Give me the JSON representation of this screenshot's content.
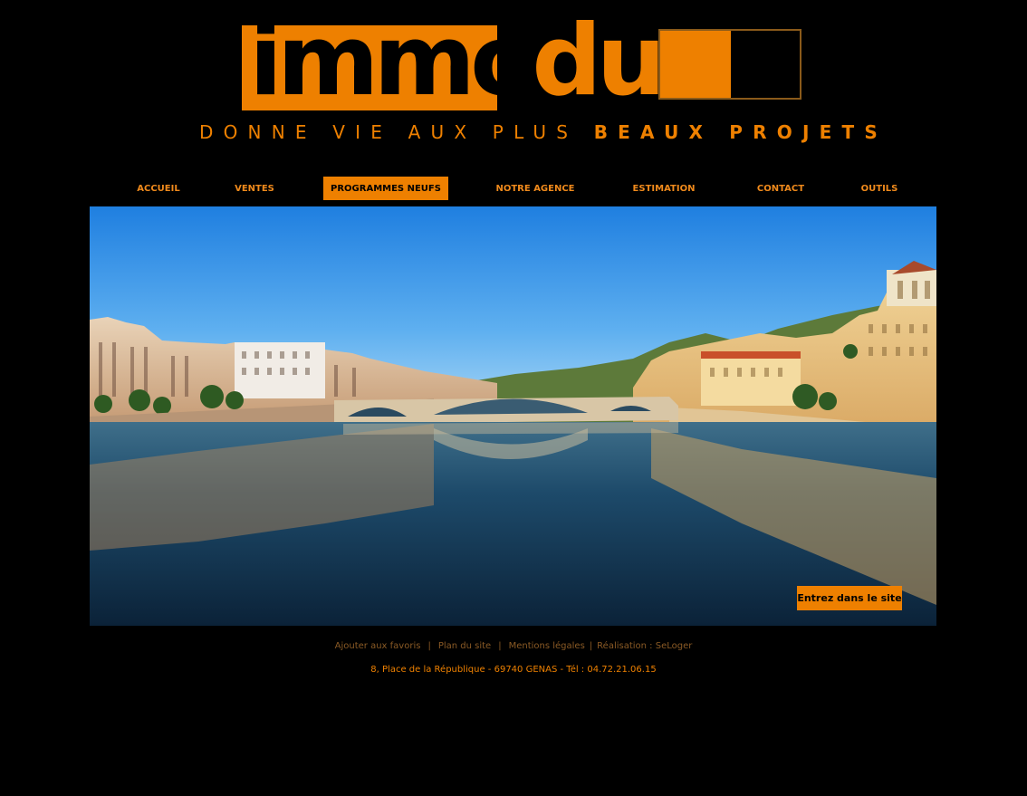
{
  "brand": {
    "logo_text_first": "immo",
    "logo_text_second": "duo",
    "tagline_light": "DONNE VIE AUX PLUS",
    "tagline_bold": "BEAUX PROJETS",
    "accent_color": "#ee8000"
  },
  "nav": {
    "items": [
      {
        "label": "ACCUEIL",
        "active": false
      },
      {
        "label": "VENTES",
        "active": false
      },
      {
        "label": "PROGRAMMES NEUFS",
        "active": true
      },
      {
        "label": "NOTRE AGENCE",
        "active": false
      },
      {
        "label": "ESTIMATION",
        "active": false
      },
      {
        "label": "CONTACT",
        "active": false
      },
      {
        "label": "OUTILS",
        "active": false
      }
    ]
  },
  "hero": {
    "enter_button_label": "Entrez dans le site"
  },
  "footer": {
    "links": [
      {
        "label": "Ajouter aux favoris"
      },
      {
        "label": "Plan du site"
      },
      {
        "label": "Mentions légales"
      },
      {
        "label": "Réalisation : SeLoger"
      }
    ],
    "separator": "|",
    "address": "8, Place de la République - 69740 GENAS - Tél : 04.72.21.06.15"
  }
}
